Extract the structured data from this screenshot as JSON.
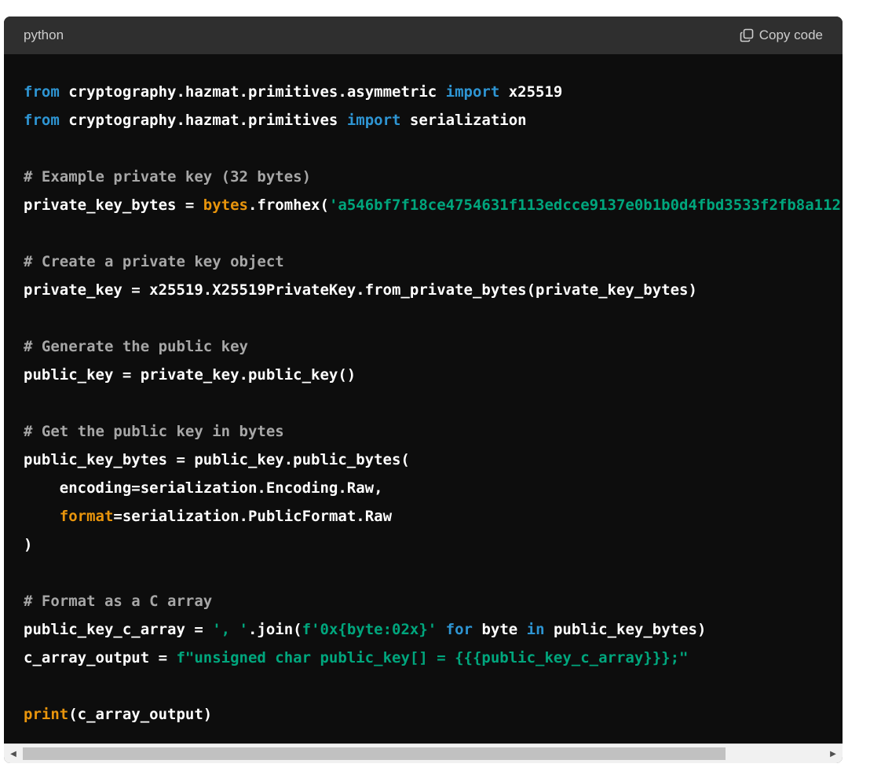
{
  "header": {
    "language": "python",
    "copy_label": "Copy code",
    "copy_icon": "copy-icon"
  },
  "colors": {
    "keyword": "#2e95d3",
    "builtin": "#e9950c",
    "string": "#00a67d",
    "comment": "#a7a7a7",
    "text": "#ffffff",
    "background": "#0d0d0d",
    "header_background": "#2f2f2f"
  },
  "code": {
    "lines": [
      [
        {
          "t": "kw",
          "v": "from"
        },
        {
          "t": "p",
          "v": " cryptography.hazmat.primitives.asymmetric "
        },
        {
          "t": "kw",
          "v": "import"
        },
        {
          "t": "p",
          "v": " x25519"
        }
      ],
      [
        {
          "t": "kw",
          "v": "from"
        },
        {
          "t": "p",
          "v": " cryptography.hazmat.primitives "
        },
        {
          "t": "kw",
          "v": "import"
        },
        {
          "t": "p",
          "v": " serialization"
        }
      ],
      [],
      [
        {
          "t": "cm",
          "v": "# Example private key (32 bytes)"
        }
      ],
      [
        {
          "t": "p",
          "v": "private_key_bytes = "
        },
        {
          "t": "fn",
          "v": "bytes"
        },
        {
          "t": "p",
          "v": ".fromhex("
        },
        {
          "t": "str",
          "v": "'a546bf7f18ce4754631f113edcce9137e0b1b0d4fbd3533f2fb8a112"
        }
      ],
      [],
      [
        {
          "t": "cm",
          "v": "# Create a private key object"
        }
      ],
      [
        {
          "t": "p",
          "v": "private_key = x25519.X25519PrivateKey.from_private_bytes(private_key_bytes)"
        }
      ],
      [],
      [
        {
          "t": "cm",
          "v": "# Generate the public key"
        }
      ],
      [
        {
          "t": "p",
          "v": "public_key = private_key.public_key()"
        }
      ],
      [],
      [
        {
          "t": "cm",
          "v": "# Get the public key in bytes"
        }
      ],
      [
        {
          "t": "p",
          "v": "public_key_bytes = public_key.public_bytes("
        }
      ],
      [
        {
          "t": "p",
          "v": "    encoding=serialization.Encoding.Raw,"
        }
      ],
      [
        {
          "t": "p",
          "v": "    "
        },
        {
          "t": "fn",
          "v": "format"
        },
        {
          "t": "p",
          "v": "=serialization.PublicFormat.Raw"
        }
      ],
      [
        {
          "t": "p",
          "v": ")"
        }
      ],
      [],
      [
        {
          "t": "cm",
          "v": "# Format as a C array"
        }
      ],
      [
        {
          "t": "p",
          "v": "public_key_c_array = "
        },
        {
          "t": "str",
          "v": "', '"
        },
        {
          "t": "p",
          "v": ".join("
        },
        {
          "t": "str",
          "v": "f'0x{byte:02x}'"
        },
        {
          "t": "p",
          "v": " "
        },
        {
          "t": "kw",
          "v": "for"
        },
        {
          "t": "p",
          "v": " byte "
        },
        {
          "t": "kw",
          "v": "in"
        },
        {
          "t": "p",
          "v": " public_key_bytes)"
        }
      ],
      [
        {
          "t": "p",
          "v": "c_array_output = "
        },
        {
          "t": "str",
          "v": "f\"unsigned char public_key[] = {{{public_key_c_array}}};\""
        }
      ],
      [],
      [
        {
          "t": "fn",
          "v": "print"
        },
        {
          "t": "p",
          "v": "(c_array_output)"
        }
      ]
    ]
  },
  "scrollbar": {
    "left_arrow": "◀",
    "right_arrow": "▶",
    "position_fraction": 0.0,
    "visible_fraction": 0.87
  }
}
